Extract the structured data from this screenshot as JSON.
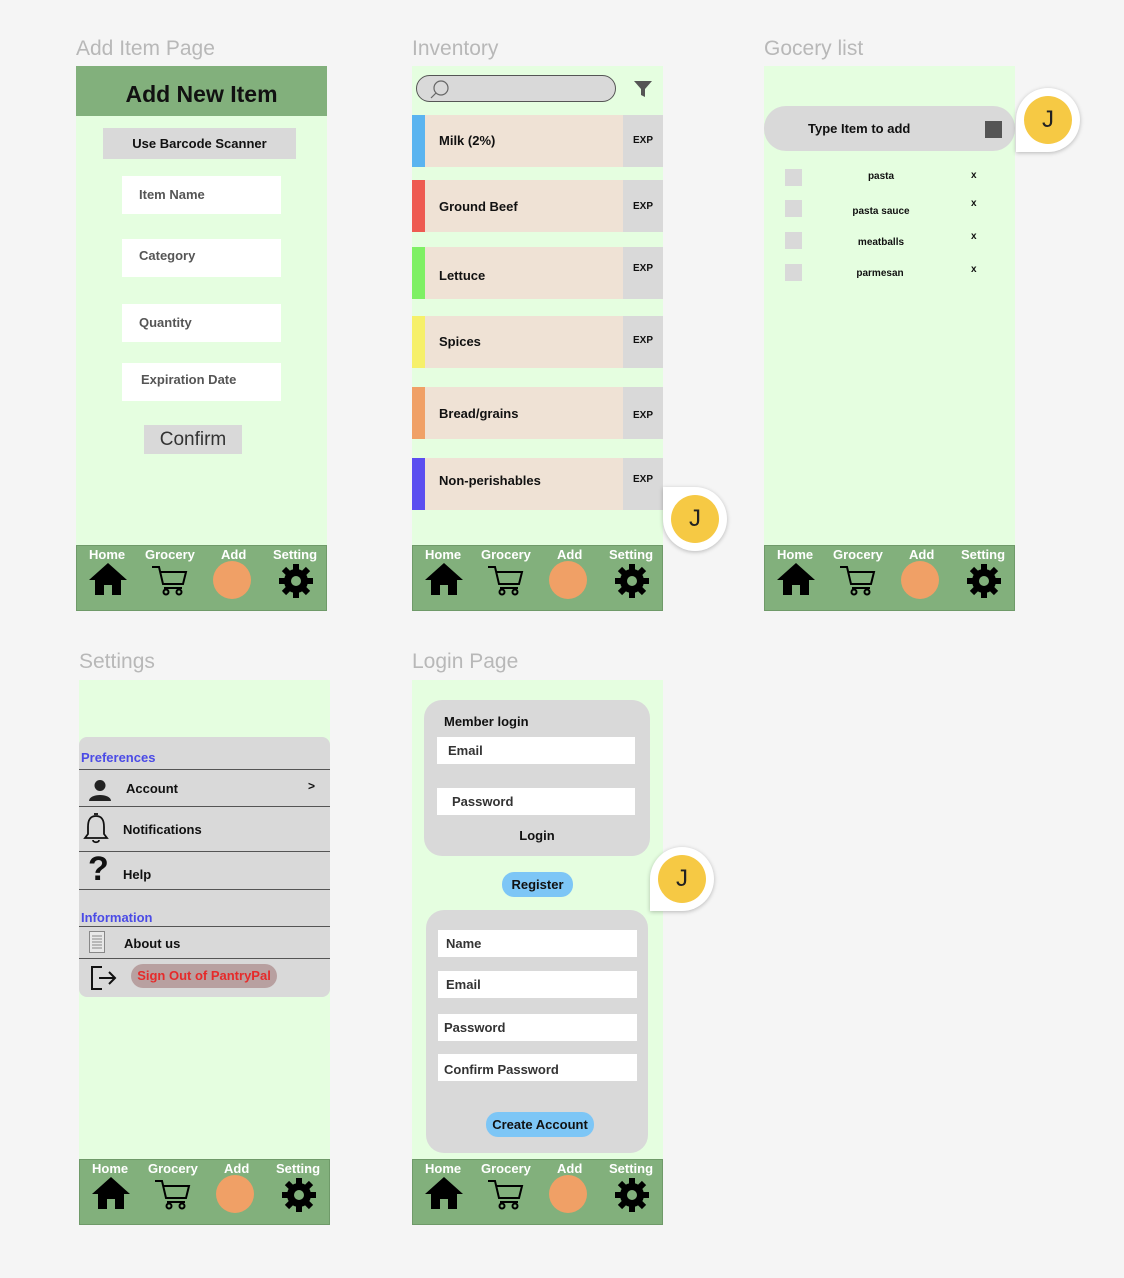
{
  "frames": {
    "add_item": "Add Item Page",
    "inventory": "Inventory",
    "grocery": "Gocery list",
    "settings": "Settings",
    "login": "Login Page"
  },
  "nav": {
    "home": "Home",
    "grocery": "Grocery",
    "add": "Add",
    "setting": "Setting"
  },
  "add_item": {
    "title": "Add New Item",
    "barcode_button": "Use Barcode Scanner",
    "item_name": "Item Name",
    "category": "Category",
    "quantity": "Quantity",
    "expiration": "Expiration Date",
    "confirm": "Confirm"
  },
  "inventory": {
    "search_placeholder": "",
    "items": [
      {
        "label": "Milk (2%)",
        "exp": "EXP",
        "color": "#5ab4f0"
      },
      {
        "label": "Ground Beef",
        "exp": "EXP",
        "color": "#ee5a52"
      },
      {
        "label": "Lettuce",
        "exp": "EXP",
        "color": "#7ef064"
      },
      {
        "label": "Spices",
        "exp": "EXP",
        "color": "#f6f06a"
      },
      {
        "label": "Bread/grains",
        "exp": "EXP",
        "color": "#f0a066"
      },
      {
        "label": "Non-perishables",
        "exp": "EXP",
        "color": "#5b4ef0"
      }
    ]
  },
  "avatar": {
    "initial": "J"
  },
  "grocery": {
    "input_placeholder": "Type Item to add",
    "items": [
      {
        "label": "pasta",
        "remove": "x"
      },
      {
        "label": "pasta sauce",
        "remove": "x"
      },
      {
        "label": "meatballs",
        "remove": "x"
      },
      {
        "label": "parmesan",
        "remove": "x"
      }
    ]
  },
  "settings": {
    "preferences": "Preferences",
    "account": "Account",
    "account_chevron": ">",
    "notifications": "Notifications",
    "help": "Help",
    "information": "Information",
    "about": "About us",
    "sign_out": "Sign Out of PantryPal"
  },
  "login": {
    "member_login": "Member login",
    "email": "Email",
    "password": "Password",
    "login_button": "Login",
    "register": "Register",
    "name": "Name",
    "reg_email": "Email",
    "reg_password": "Password",
    "confirm_password": "Confirm Password",
    "create_account": "Create Account"
  }
}
